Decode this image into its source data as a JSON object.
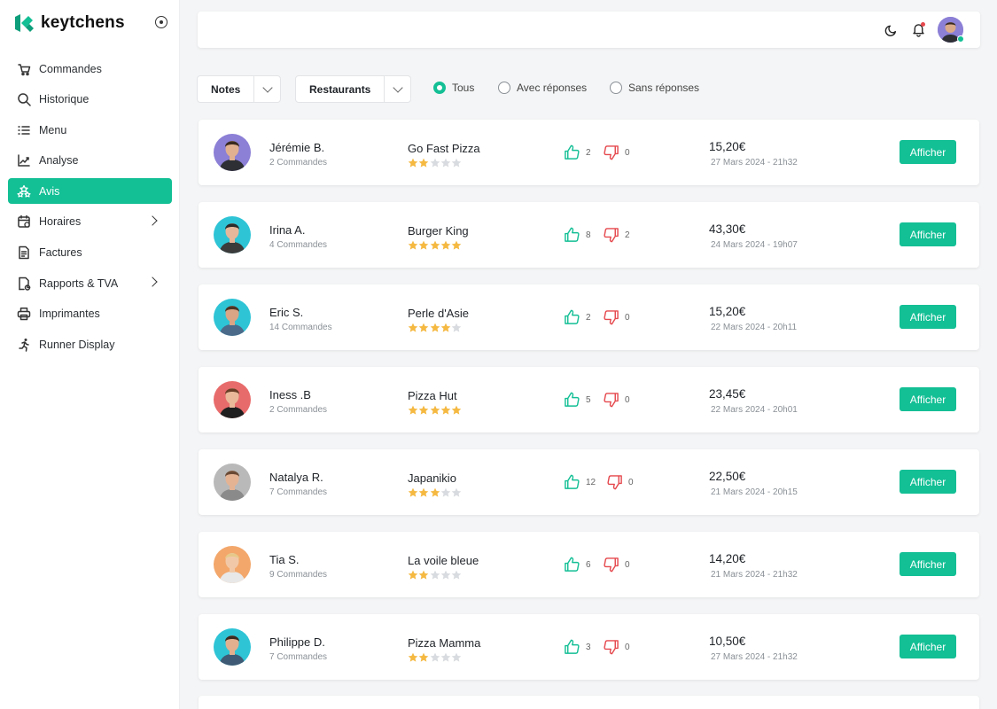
{
  "brand": {
    "name": "keytchens",
    "color": "#13bf95"
  },
  "sidebar": {
    "items": [
      {
        "label": "Commandes",
        "icon": "cart-icon",
        "active": false,
        "chevron": false
      },
      {
        "label": "Historique",
        "icon": "search-icon",
        "active": false,
        "chevron": false
      },
      {
        "label": "Menu",
        "icon": "list-icon",
        "active": false,
        "chevron": false
      },
      {
        "label": "Analyse",
        "icon": "analytics-icon",
        "active": false,
        "chevron": false
      },
      {
        "label": "Avis",
        "icon": "stars-icon",
        "active": true,
        "chevron": false
      },
      {
        "label": "Horaires",
        "icon": "calendar-icon",
        "active": false,
        "chevron": true
      },
      {
        "label": "Factures",
        "icon": "invoice-icon",
        "active": false,
        "chevron": false
      },
      {
        "label": "Rapports & TVA",
        "icon": "report-icon",
        "active": false,
        "chevron": true
      },
      {
        "label": "Imprimantes",
        "icon": "printer-icon",
        "active": false,
        "chevron": false
      },
      {
        "label": "Runner Display",
        "icon": "runner-icon",
        "active": false,
        "chevron": false
      }
    ]
  },
  "topbar": {
    "icons": [
      "moon-icon",
      "bell-icon",
      "avatar"
    ],
    "has_notification": true,
    "online": true
  },
  "filters": {
    "selects": [
      {
        "label": "Notes"
      },
      {
        "label": "Restaurants"
      }
    ],
    "radios": [
      {
        "label": "Tous",
        "checked": true
      },
      {
        "label": "Avec réponses",
        "checked": false
      },
      {
        "label": "Sans réponses",
        "checked": false
      }
    ]
  },
  "reviews": [
    {
      "name": "Jérémie B.",
      "orders": "2 Commandes",
      "restaurant": "Go Fast Pizza",
      "rating": 2,
      "likes": "2",
      "dislikes": "0",
      "price": "15,20€",
      "date": "27 Mars 2024 - 21h32",
      "button": "Afficher",
      "avatar_bg": "#8b7fd6"
    },
    {
      "name": "Irina A.",
      "orders": "4 Commandes",
      "restaurant": "Burger King",
      "rating": 5,
      "likes": "8",
      "dislikes": "2",
      "price": "43,30€",
      "date": "24 Mars 2024 - 19h07",
      "button": "Afficher",
      "avatar_bg": "#2ec4d6"
    },
    {
      "name": "Eric S.",
      "orders": "14 Commandes",
      "restaurant": "Perle d'Asie",
      "rating": 4,
      "likes": "2",
      "dislikes": "0",
      "price": "15,20€",
      "date": "22 Mars 2024 - 20h11",
      "button": "Afficher",
      "avatar_bg": "#2ec4d6"
    },
    {
      "name": "Iness .B",
      "orders": "2 Commandes",
      "restaurant": "Pizza Hut",
      "rating": 5,
      "likes": "5",
      "dislikes": "0",
      "price": "23,45€",
      "date": "22 Mars 2024 - 20h01",
      "button": "Afficher",
      "avatar_bg": "#e86b6b"
    },
    {
      "name": "Natalya R.",
      "orders": "7 Commandes",
      "restaurant": "Japanikio",
      "rating": 3,
      "likes": "12",
      "dislikes": "0",
      "price": "22,50€",
      "date": "21 Mars 2024 - 20h15",
      "button": "Afficher",
      "avatar_bg": "#b9b9b9"
    },
    {
      "name": "Tia S.",
      "orders": "9 Commandes",
      "restaurant": "La voile bleue",
      "rating": 2,
      "likes": "6",
      "dislikes": "0",
      "price": "14,20€",
      "date": "21 Mars 2024 - 21h32",
      "button": "Afficher",
      "avatar_bg": "#f3a76b"
    },
    {
      "name": "Philippe D.",
      "orders": "7 Commandes",
      "restaurant": "Pizza Mamma",
      "rating": 2,
      "likes": "3",
      "dislikes": "0",
      "price": "10,50€",
      "date": "27 Mars 2024 - 21h32",
      "button": "Afficher",
      "avatar_bg": "#2ec4d6"
    }
  ],
  "colors": {
    "accent": "#13bf95",
    "like": "#13bf95",
    "dislike": "#e5484d",
    "star_on": "#f5b942",
    "star_off": "#d8dbdf"
  }
}
